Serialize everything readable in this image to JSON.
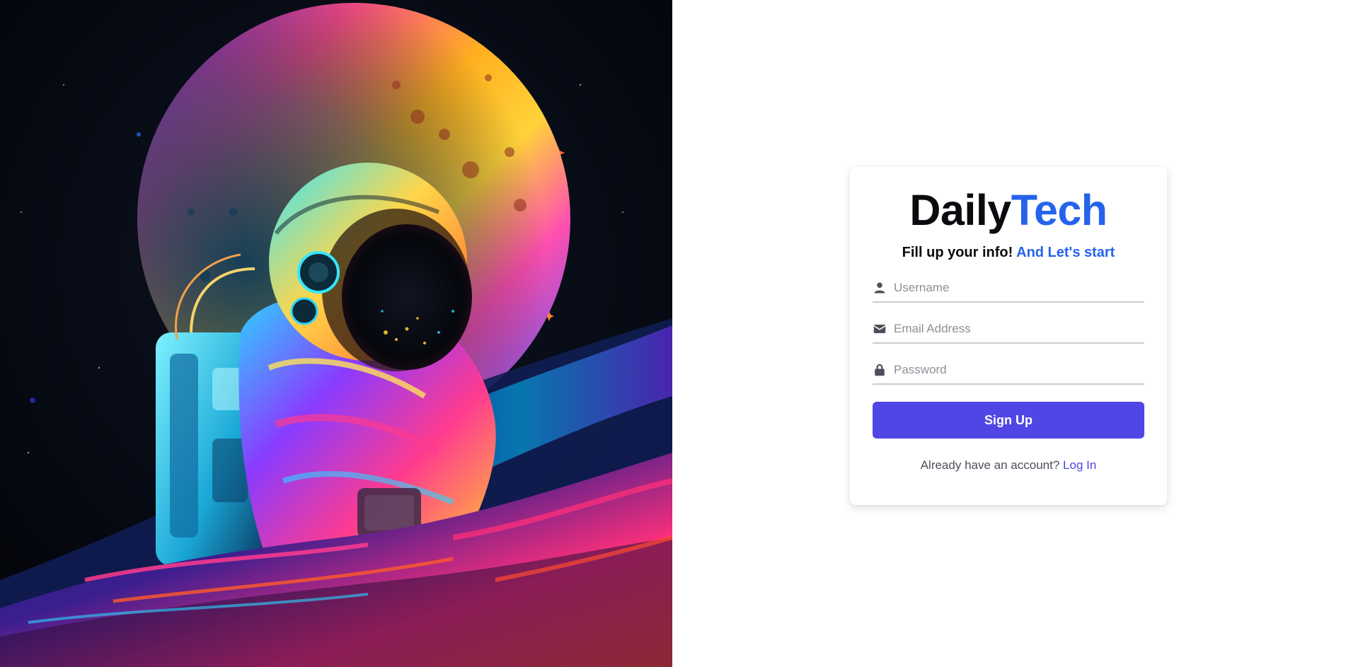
{
  "colors": {
    "accent_blue": "#2563eb",
    "button_bg": "#4f46e5",
    "link_color": "#4f46e5"
  },
  "art": {
    "icon": "astronaut-artwork"
  },
  "brand": {
    "part1": "Daily",
    "part2": "Tech"
  },
  "tagline": {
    "part1": "Fill up your info!",
    "part2": "And Let's start"
  },
  "fields": {
    "username": {
      "placeholder": "Username",
      "icon": "user-icon"
    },
    "email": {
      "placeholder": "Email Address",
      "icon": "envelope-icon"
    },
    "password": {
      "placeholder": "Password",
      "icon": "lock-icon"
    }
  },
  "signup_label": "Sign Up",
  "footer": {
    "prompt": "Already have an account?",
    "login_label": "Log In"
  }
}
